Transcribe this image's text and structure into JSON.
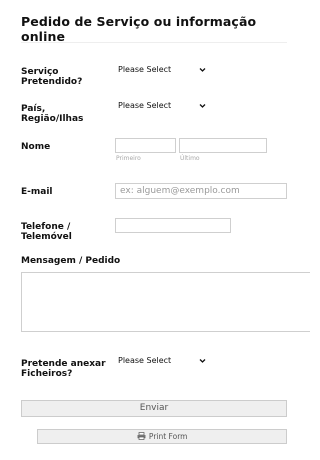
{
  "form": {
    "title": "Pedido de Serviço ou informação online",
    "service": {
      "label_line1": "Serviço",
      "label_line2": "Pretendido?",
      "selected": "Please Select"
    },
    "country": {
      "label_line1": "País,",
      "label_line2": "Região/Ilhas",
      "selected": "Please Select"
    },
    "name": {
      "label": "Nome",
      "first_sublabel": "Primeiro",
      "last_sublabel": "Último"
    },
    "email": {
      "label": "E-mail",
      "placeholder": "ex: alguem@exemplo.com"
    },
    "phone": {
      "label_line1": "Telefone /",
      "label_line2": "Telemóvel"
    },
    "message": {
      "label": "Mensagem / Pedido"
    },
    "attach": {
      "label_line1": "Pretende anexar",
      "label_line2": "Ficheiros?",
      "selected": "Please Select"
    },
    "submit_label": "Enviar",
    "print_label": "Print Form",
    "print_icon": "printer-icon"
  }
}
